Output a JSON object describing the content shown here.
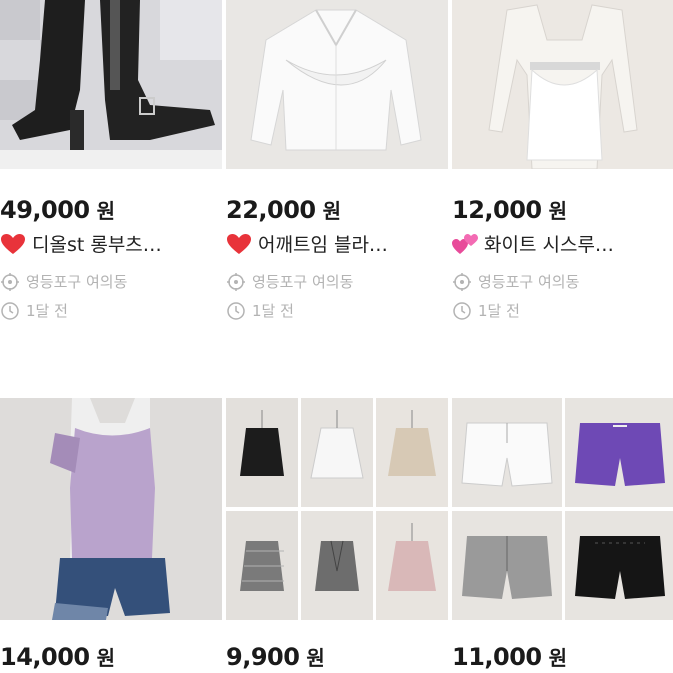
{
  "listings": [
    {
      "price": "49,000",
      "currency": "원",
      "title": "디올st 롱부츠…",
      "emoji": "heart-red",
      "location": "영등포구 여의동",
      "time": "1달 전"
    },
    {
      "price": "22,000",
      "currency": "원",
      "title": "어깨트임 블라…",
      "emoji": "heart-red",
      "location": "영등포구 여의동",
      "time": "1달 전"
    },
    {
      "price": "12,000",
      "currency": "원",
      "title": "화이트 시스루…",
      "emoji": "two-hearts-pink",
      "location": "영등포구 여의동",
      "time": "1달 전"
    },
    {
      "price": "14,000",
      "currency": "원"
    },
    {
      "price": "9,900",
      "currency": "원"
    },
    {
      "price": "11,000",
      "currency": "원"
    }
  ],
  "colors": {
    "price": "#1a1a1a",
    "meta": "#b3b3b3",
    "heart": "#e8333a",
    "pink_heart": "#e84b9a"
  },
  "icons": {
    "location": "location-target-icon",
    "time": "clock-icon"
  }
}
